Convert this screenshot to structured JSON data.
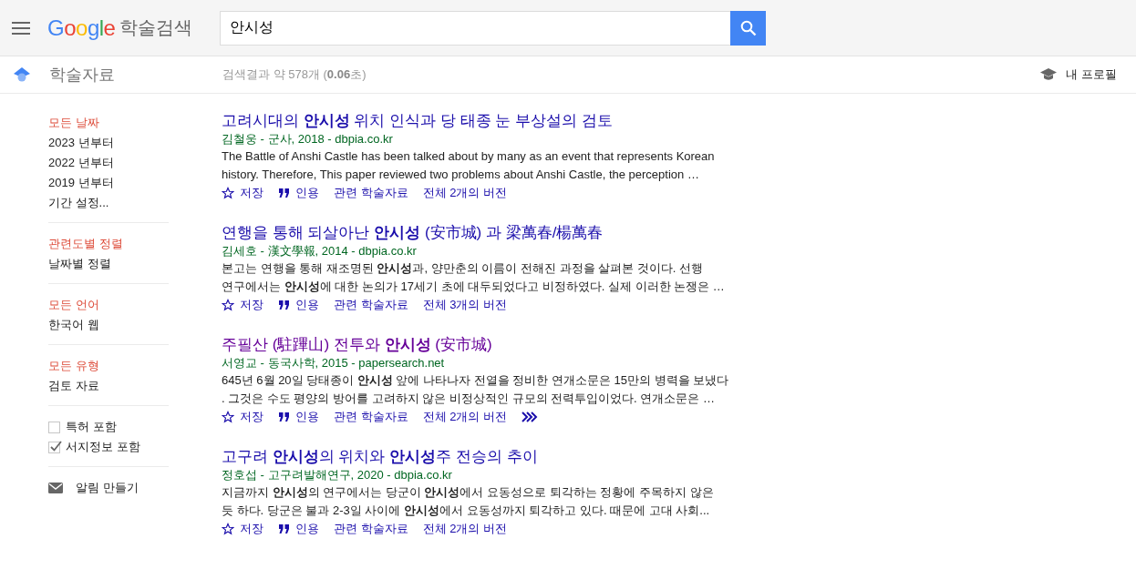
{
  "header": {
    "logo": "Google",
    "product": "학술검색",
    "search": {
      "value": "안시성"
    }
  },
  "subbar": {
    "section": "학술자료",
    "result_count": "검색결과 약 578개 (**0.06**초)",
    "profile": "내 프로필"
  },
  "sidebar": {
    "groups": [
      {
        "items": [
          {
            "label": "모든 날짜",
            "selected": true
          },
          {
            "label": "2023 년부터",
            "selected": false
          },
          {
            "label": "2022 년부터",
            "selected": false
          },
          {
            "label": "2019 년부터",
            "selected": false
          },
          {
            "label": "기간 설정...",
            "selected": false
          }
        ]
      },
      {
        "items": [
          {
            "label": "관련도별 정렬",
            "selected": true
          },
          {
            "label": "날짜별 정렬",
            "selected": false
          }
        ]
      },
      {
        "items": [
          {
            "label": "모든 언어",
            "selected": true
          },
          {
            "label": "한국어 웹",
            "selected": false
          }
        ]
      },
      {
        "items": [
          {
            "label": "모든 유형",
            "selected": true
          },
          {
            "label": "검토 자료",
            "selected": false
          }
        ]
      }
    ],
    "checkboxes": [
      {
        "label": "특허 포함",
        "checked": false
      },
      {
        "label": "서지정보 포함",
        "checked": true
      }
    ],
    "alert": "알림 만들기"
  },
  "results": [
    {
      "title": "고려시대의 **안시성** 위치 인식과 당 태종 눈 부상설의 검토",
      "visited": false,
      "source": "김철웅 - 군사, 2018 - dbpia.co.kr",
      "snippet": [
        "The Battle of Anshi Castle has been talked about by many as an event that represents Korean",
        "history. Therefore, This paper reviewed two problems about Anshi Castle, the perception …"
      ],
      "actions": [
        "저장",
        "인용",
        "관련 학술자료",
        "전체 2개의 버전"
      ],
      "more": false
    },
    {
      "title": "연행을 통해 되살아난 **안시성** (安市城) 과 梁萬春/楊萬春",
      "visited": false,
      "source": "김세호 - 漢文學報, 2014 - dbpia.co.kr",
      "snippet": [
        "본고는 연행을 통해 재조명된 **안시성**과, 양만춘의 이름이 전해진 과정을 살펴본 것이다. 선행",
        "연구에서는 **안시성**에 대한 논의가 17세기 초에 대두되었다고 비정하였다. 실제 이러한 논쟁은 …"
      ],
      "actions": [
        "저장",
        "인용",
        "관련 학술자료",
        "전체 3개의 버전"
      ],
      "more": false
    },
    {
      "title": "주필산 (駐蹕山) 전투와 **안시성** (安市城)",
      "visited": true,
      "source": "서영교 - 동국사학, 2015 - papersearch.net",
      "snippet": [
        "645년 6월 20일 당태종이 **안시성** 앞에 나타나자 전열을 정비한 연개소문은 15만의 병력을 보냈다",
        ". 그것은 수도 평양의 방어를 고려하지 않은 비정상적인 규모의 전력투입이었다. 연개소문은 …"
      ],
      "actions": [
        "저장",
        "인용",
        "관련 학술자료",
        "전체 2개의 버전"
      ],
      "more": true
    },
    {
      "title": "고구려 **안시성**의 위치와 **안시성**주 전승의 추이",
      "visited": false,
      "source": "정호섭 - 고구려발해연구, 2020 - dbpia.co.kr",
      "snippet": [
        "지금까지 **안시성**의 연구에서는 당군이 **안시성**에서 요동성으로 퇴각하는 정황에 주목하지 않은",
        "듯 하다. 당군은 불과 2-3일 사이에 **안시성**에서 요동성까지 퇴각하고 있다. 때문에 고대 사회..."
      ],
      "actions": [
        "저장",
        "인용",
        "관련 학술자료",
        "전체 2개의 버전"
      ],
      "more": false
    }
  ]
}
